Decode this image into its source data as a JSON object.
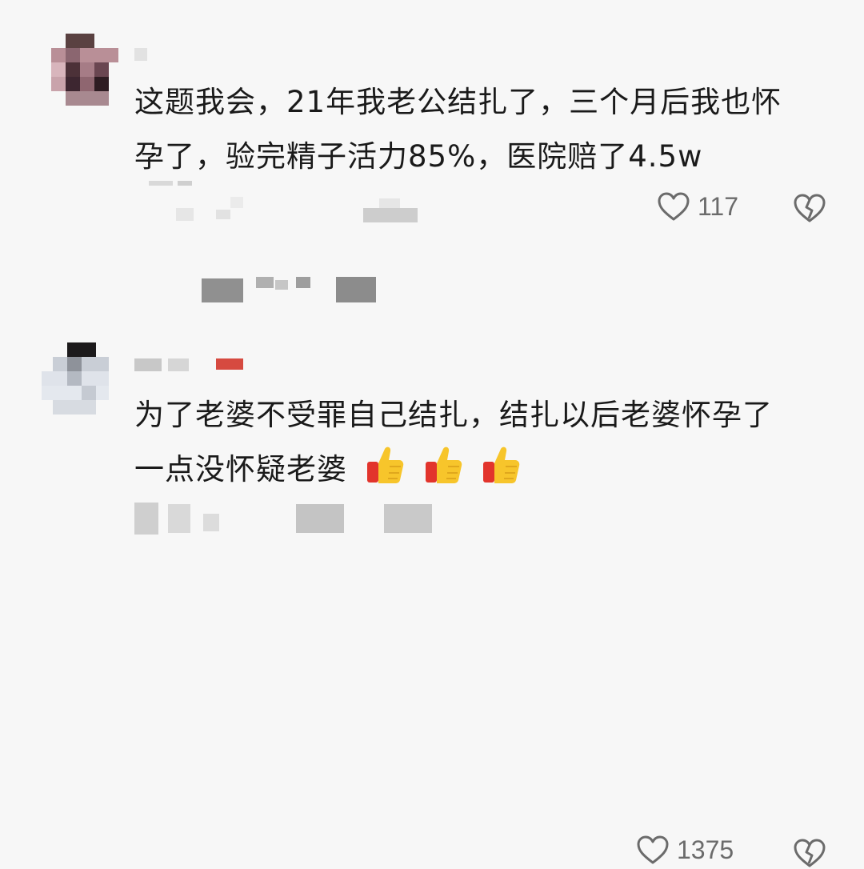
{
  "comments": [
    {
      "text_line1": "这题我会，21年我老公结扎了，三个月后我也怀",
      "text_line2": "孕了，验完精子活力85%，医院赔了4.5w",
      "like_count": "117",
      "like_icon": "heart-outline-icon",
      "dislike_icon": "broken-heart-icon"
    },
    {
      "text_line1": "为了老婆不受罪自己结扎，结扎以后老婆怀孕了",
      "text_line2": "一点没怀疑老婆",
      "emoji": [
        "thumbs-up-icon",
        "thumbs-up-icon",
        "thumbs-up-icon"
      ],
      "like_count": "1375",
      "like_icon": "heart-outline-icon",
      "dislike_icon": "broken-heart-icon"
    }
  ],
  "colors": {
    "background": "#f7f7f7",
    "text": "#1a1a1a",
    "icon": "#6b6b6b",
    "emoji_yellow": "#f7c52b",
    "emoji_red": "#e2342c"
  }
}
